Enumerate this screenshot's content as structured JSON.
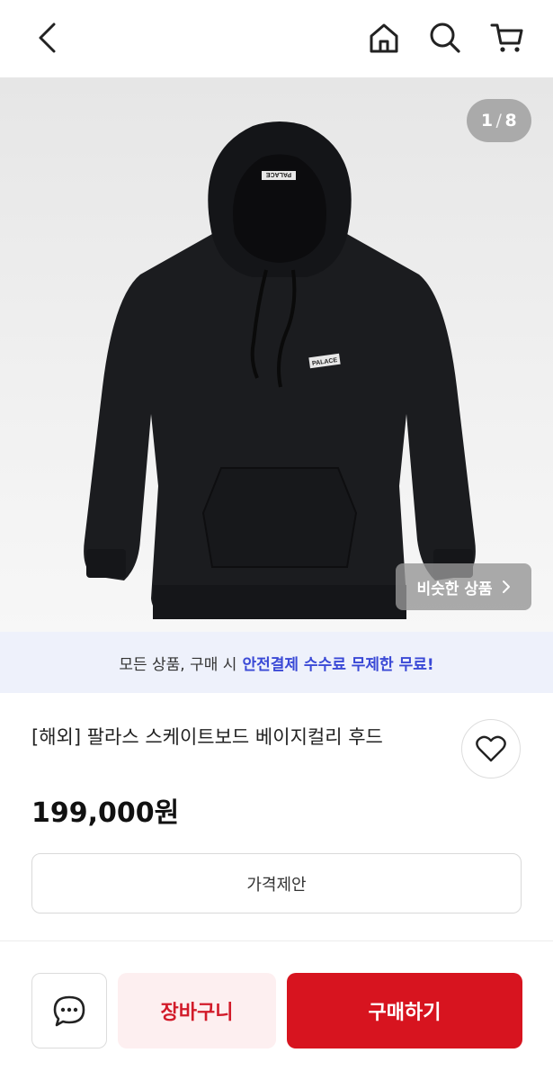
{
  "header": {
    "back_icon": "chevron-left-icon",
    "home_icon": "home-icon",
    "search_icon": "search-icon",
    "cart_icon": "cart-icon"
  },
  "gallery": {
    "current": "1",
    "separator": "/",
    "total": "8",
    "similar_label": "비슷한 상품",
    "similar_icon": "chevron-right-icon",
    "image_logo_text": "PALACE"
  },
  "banner": {
    "text": "모든 상품, 구매 시",
    "accent_text": "안전결제 수수료 무제한 무료!",
    "accent_color": "#3a49d6"
  },
  "product": {
    "title": "[해외] 팔라스 스케이트보드 베이지컬리 후드",
    "price": "199,000원",
    "offer_label": "가격제안",
    "like_icon": "heart-icon"
  },
  "bottom_bar": {
    "chat_icon": "chat-bubble-icon",
    "cart_label": "장바구니",
    "buy_label": "구매하기",
    "buy_color": "#d7141f",
    "cart_bg": "#fdeff0"
  }
}
